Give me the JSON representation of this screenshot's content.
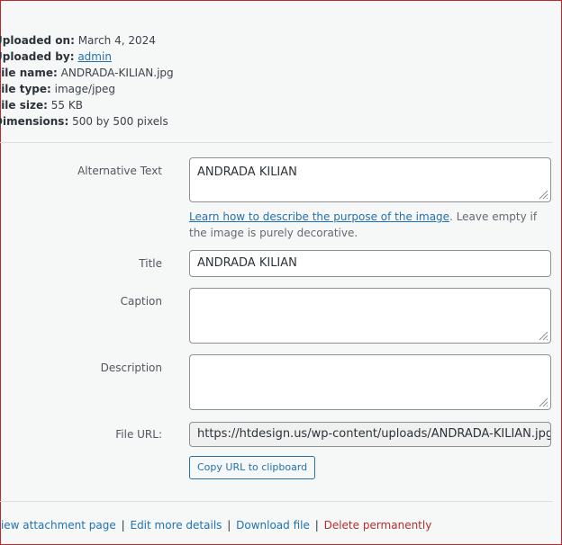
{
  "details": {
    "uploaded_on_label": "Uploaded on:",
    "uploaded_on_value": "March 4, 2024",
    "uploaded_by_label": "Uploaded by:",
    "uploaded_by_value": "admin",
    "file_name_label": "File name:",
    "file_name_value": "ANDRADA-KILIAN.jpg",
    "file_type_label": "File type:",
    "file_type_value": "image/jpeg",
    "file_size_label": "File size:",
    "file_size_value": "55 KB",
    "dimensions_label": "Dimensions:",
    "dimensions_value": "500 by 500 pixels"
  },
  "form": {
    "alt_text_label": "Alternative Text",
    "alt_text_value": "ANDRADA KILIAN",
    "help_link": "Learn how to describe the purpose of the image",
    "help_text": ". Leave empty if the image is purely decorative.",
    "title_label": "Title",
    "title_value": "ANDRADA KILIAN",
    "caption_label": "Caption",
    "caption_value": "",
    "description_label": "Description",
    "description_value": "",
    "file_url_label": "File URL:",
    "file_url_value": "https://htdesign.us/wp-content/uploads/ANDRADA-KILIAN.jpg",
    "copy_button": "Copy URL to clipboard"
  },
  "actions": {
    "view_attachment": "View attachment page",
    "edit_more": "Edit more details",
    "download": "Download file",
    "delete": "Delete permanently",
    "separator": "|"
  },
  "colors": {
    "link": "#2271b1",
    "danger": "#b32d2e",
    "frame": "#c3262f",
    "background": "#f6f7f7"
  }
}
